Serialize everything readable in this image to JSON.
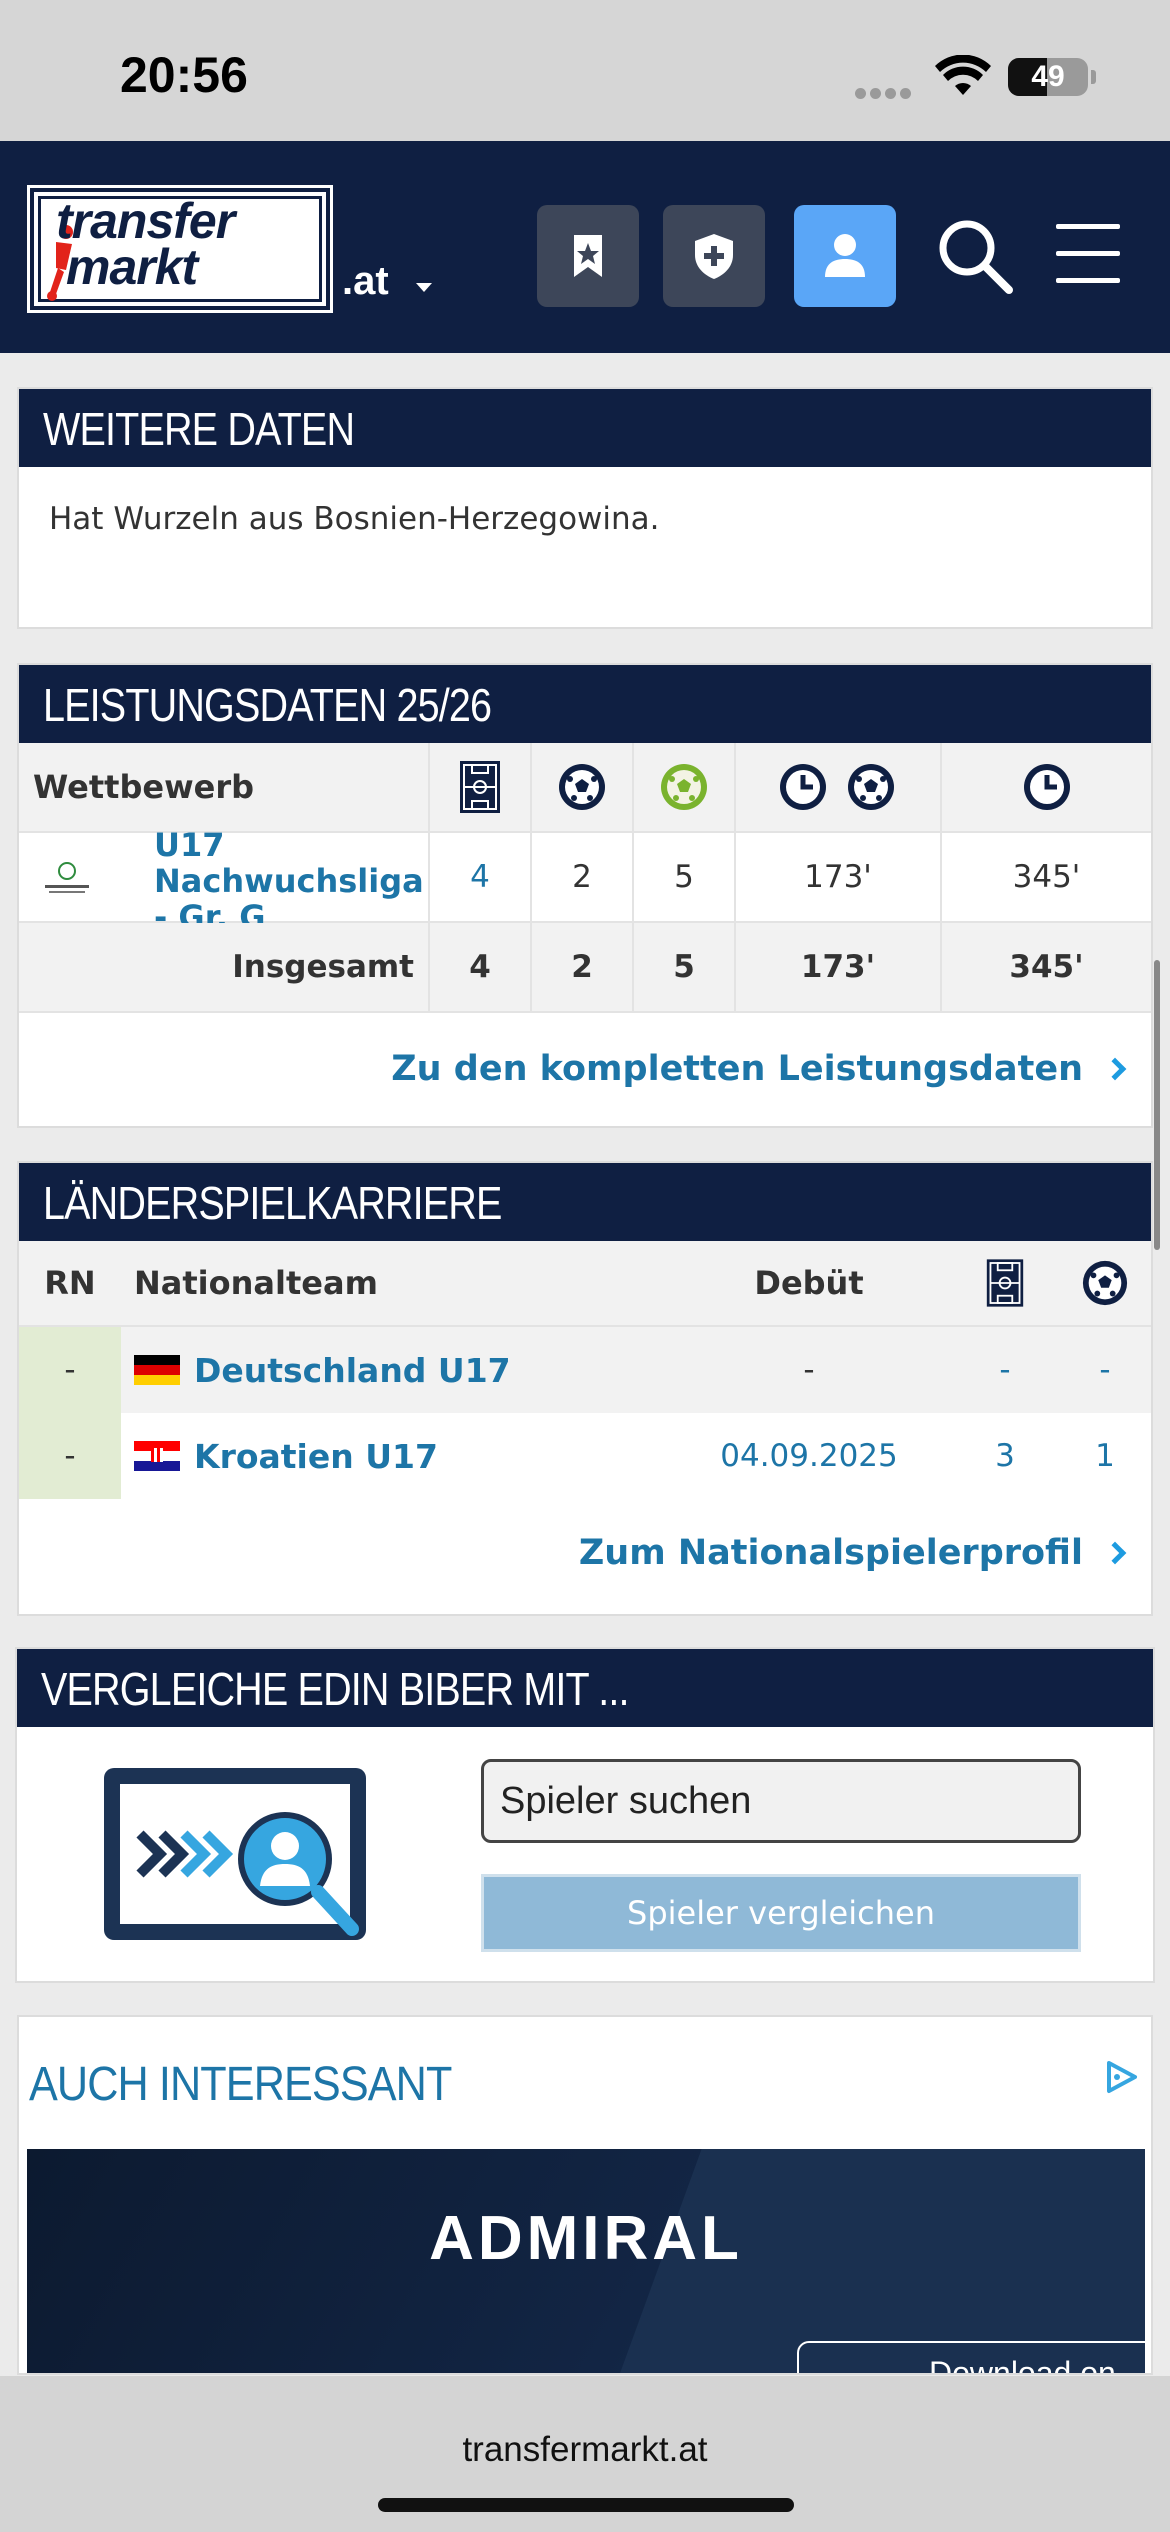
{
  "status_bar": {
    "time": "20:56",
    "battery": "49"
  },
  "header": {
    "logo_line1": "transfer",
    "logo_line2": "markt",
    "domain": ".at",
    "icons": [
      "bookmark-star-icon",
      "shield-plus-icon",
      "user-icon",
      "search-icon",
      "menu-icon"
    ]
  },
  "weitere_daten": {
    "title": "WEITERE DATEN",
    "text": "Hat Wurzeln aus Bosnien-Herzegowina."
  },
  "leistungsdaten": {
    "title": "LEISTUNGSDATEN 25/26",
    "columns": [
      "Wettbewerb",
      "pitch-icon",
      "ball-icon",
      "green-ball-icon",
      "clock-ball-icon",
      "clock-icon"
    ],
    "rows": [
      {
        "competition": "U17 Nachwuchsliga - Gr. G",
        "apps": "4",
        "goals": "2",
        "assists": "5",
        "minutes_per_goal": "173'",
        "minutes": "345'"
      }
    ],
    "total": {
      "label": "Insgesamt",
      "apps": "4",
      "goals": "2",
      "assists": "5",
      "minutes_per_goal": "173'",
      "minutes": "345'"
    },
    "link": "Zu den kompletten Leistungsdaten"
  },
  "laenderspiel": {
    "title": "LÄNDERSPIELKARRIERE",
    "columns": {
      "rn": "RN",
      "team": "Nationalteam",
      "debut": "Debüt"
    },
    "rows": [
      {
        "rn": "-",
        "team": "Deutschland U17",
        "debut": "-",
        "apps": "-",
        "goals": "-"
      },
      {
        "rn": "-",
        "team": "Kroatien U17",
        "debut": "04.09.2025",
        "apps": "3",
        "goals": "1"
      }
    ],
    "link": "Zum Nationalspielerprofil"
  },
  "vergleiche": {
    "title": "VERGLEICHE EDIN BIBER MIT ...",
    "search_placeholder": "Spieler suchen",
    "button": "Spieler vergleichen"
  },
  "auch_interessant": {
    "title": "AUCH INTERESSANT",
    "ad_brand": "ADMIRAL",
    "ad_button": "Download on"
  },
  "browser": {
    "url": "transfermarkt.at"
  },
  "colors": {
    "navy": "#0f1f42",
    "link": "#1d75a7",
    "accent_blue": "#5aa6f7"
  }
}
